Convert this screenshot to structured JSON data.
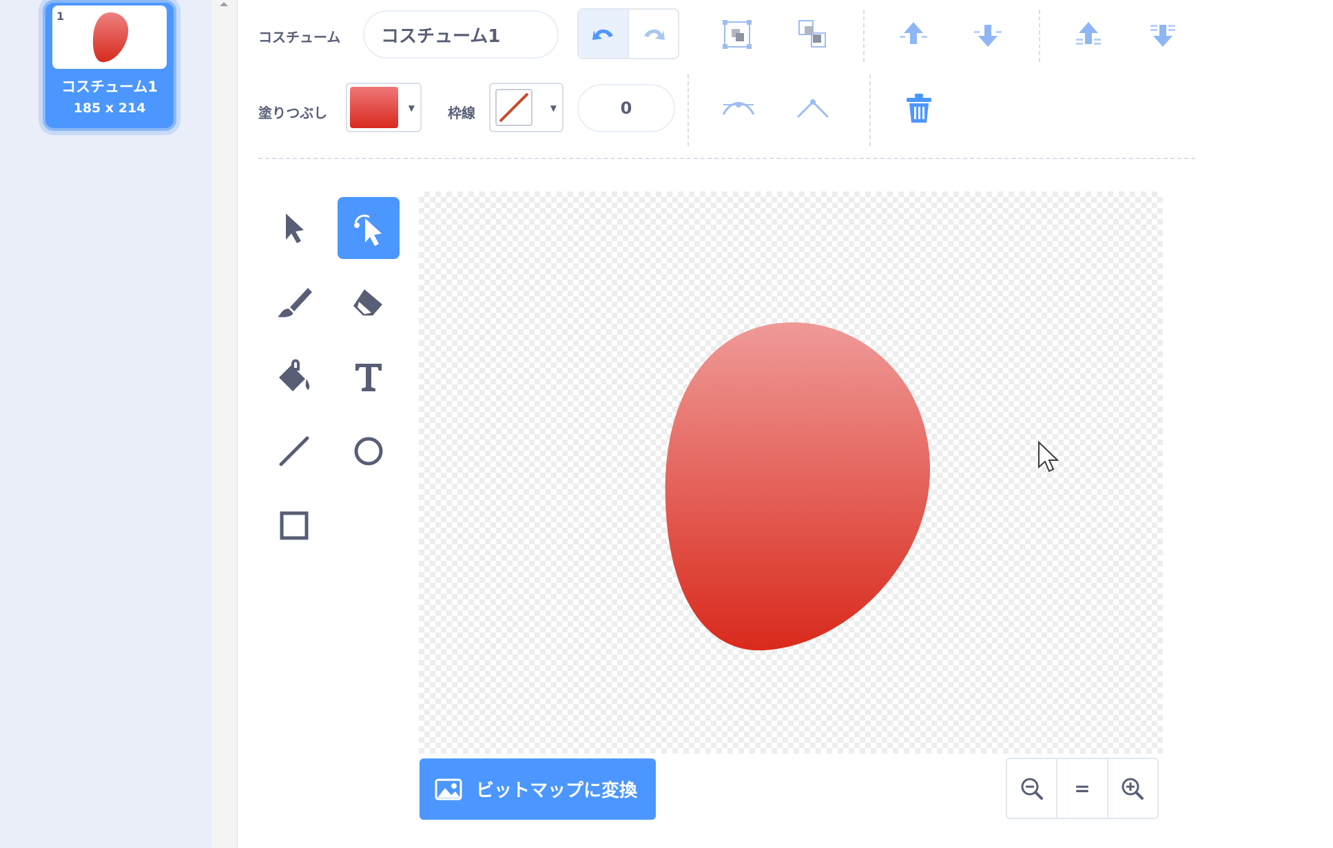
{
  "costume_list": {
    "items": [
      {
        "number": "1",
        "name": "コスチューム1",
        "size": "185 x 214",
        "selected": true
      }
    ]
  },
  "toolbar": {
    "costume_label": "コスチューム",
    "costume_name_value": "コスチューム1",
    "fill_label": "塗りつぶし",
    "outline_label": "枠線",
    "outline_width_value": "0",
    "fill_color": "#e03a2f"
  },
  "tools": [
    {
      "id": "select",
      "icon": "select-arrow-icon",
      "active": false
    },
    {
      "id": "reshape",
      "icon": "reshape-icon",
      "active": true
    },
    {
      "id": "brush",
      "icon": "brush-icon",
      "active": false
    },
    {
      "id": "eraser",
      "icon": "eraser-icon",
      "active": false
    },
    {
      "id": "fill",
      "icon": "paint-bucket-icon",
      "active": false
    },
    {
      "id": "text",
      "icon": "text-icon",
      "active": false
    },
    {
      "id": "line",
      "icon": "line-icon",
      "active": false
    },
    {
      "id": "circle",
      "icon": "circle-icon",
      "active": false
    },
    {
      "id": "rectangle",
      "icon": "rectangle-icon",
      "active": false
    }
  ],
  "canvas": {
    "shape_color_top": "#ef9a98",
    "shape_color_bottom": "#d92a1c"
  },
  "footer": {
    "convert_bitmap_label": "ビットマップに変換",
    "zoom_reset_label": "="
  },
  "colors": {
    "accent": "#4c97ff",
    "text": "#575e75",
    "sidebar_bg": "#e9eef8"
  }
}
